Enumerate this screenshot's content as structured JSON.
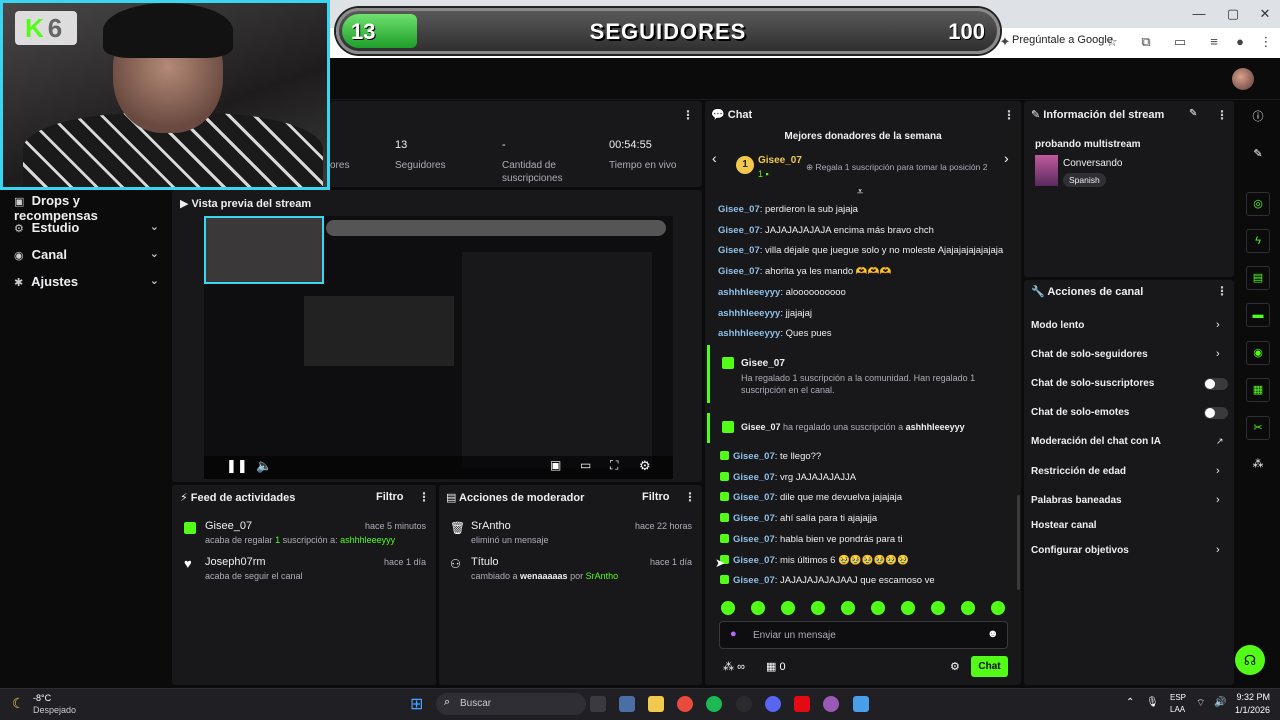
{
  "browser": {
    "ask_google": "Pregúntale a Google"
  },
  "goal_overlay": {
    "current": "13",
    "title": "SEGUIDORES",
    "target": "100",
    "progress": 0.13
  },
  "webcam": {
    "logo_letter": "K",
    "logo_number": "6"
  },
  "stats": [
    {
      "value": "13",
      "label": "Seguidores"
    },
    {
      "value": "-",
      "label": "Cantidad de suscripciones"
    },
    {
      "value": "00:54:55",
      "label": "Tiempo en vivo"
    }
  ],
  "stats_partial_label": "ores",
  "sidebar": {
    "items": [
      {
        "label": "Drops y recompensas",
        "icon": "gift-icon",
        "chevron": false
      },
      {
        "label": "Estudio",
        "icon": "studio-icon",
        "chevron": true
      },
      {
        "label": "Canal",
        "icon": "channel-icon",
        "chevron": true
      },
      {
        "label": "Ajustes",
        "icon": "gear-icon",
        "chevron": true
      }
    ]
  },
  "preview": {
    "title": "Vista previa del stream"
  },
  "activity_feed": {
    "title": "Feed de actividades",
    "filter": "Filtro",
    "items": [
      {
        "name": "Gisee_07",
        "time": "hace 5 minutos",
        "pre": "acaba de regalar ",
        "count": "1",
        "mid": " suscripción a: ",
        "target": "ashhhleeeyyy"
      },
      {
        "name": "Joseph07rm",
        "time": "hace 1 día",
        "text": "acaba de seguir el canal"
      }
    ]
  },
  "mod_actions": {
    "title": "Acciones de moderador",
    "filter": "Filtro",
    "items": [
      {
        "name": "SrAntho",
        "time": "hace 22 horas",
        "text": "eliminó un mensaje"
      },
      {
        "name": "Título",
        "time": "hace 1 día",
        "pre": "cambiado a ",
        "value": "wenaaaaas",
        "by": " por ",
        "user": "SrAntho"
      }
    ]
  },
  "chat": {
    "title": "Chat",
    "top_donors_title": "Mejores donadores de la semana",
    "donor_rank": "1",
    "donor_name": "Gisee_07",
    "donor_count": "1",
    "donor_cta": "Regala 1 suscripción para tomar la posición 2",
    "messages_top": [
      {
        "user": "Gisee_07",
        "text": ": perdieron la sub jajaja"
      },
      {
        "user": "Gisee_07",
        "text": ": JAJAJAJAJAJA encima más bravo chch"
      },
      {
        "user": "Gisee_07",
        "text": ": villa déjale que juegue solo y no moleste Ajajajajajajajaja"
      },
      {
        "user": "Gisee_07",
        "text": ": ahorita ya les mando 🫶🫶🫶"
      },
      {
        "user": "ashhhleeeyyy",
        "text": ": aloooooooooo"
      },
      {
        "user": "ashhhleeeyyy",
        "text": ": jjajajaj"
      },
      {
        "user": "ashhhleeeyyy",
        "text": ": Ques pues"
      }
    ],
    "gift_event": {
      "user": "Gisee_07",
      "text": "Ha regalado 1 suscripción a la comunidad. Han regalado 1 suscripción en el canal."
    },
    "gift_single": {
      "user": "Gisee_07",
      "text": " ha regalado una suscripción a ",
      "target": "ashhhleeeyyy"
    },
    "messages_bottom": [
      {
        "user": "Gisee_07",
        "text": ": te llego??"
      },
      {
        "user": "Gisee_07",
        "text": ": vrg JAJAJAJAJJA"
      },
      {
        "user": "Gisee_07",
        "text": ": dile que me devuelva jajajaja"
      },
      {
        "user": "Gisee_07",
        "text": ": ahí salía para ti ajajajja"
      },
      {
        "user": "Gisee_07",
        "text": ": habla bien ve pondrás para ti"
      },
      {
        "user": "Gisee_07",
        "text": ": mis últimos 6 🥹🥹🥹🥹🥹🥹"
      },
      {
        "user": "Gisee_07",
        "text": ": JAJAJAJAJAJAAJ que escamoso ve"
      }
    ],
    "input_placeholder": "Enviar un mensaje",
    "infinity": "∞",
    "count": "0",
    "send_label": "Chat"
  },
  "stream_info": {
    "title": "Información del stream",
    "stream_title": "probando multistream",
    "category": "Conversando",
    "language": "Spanish"
  },
  "channel_actions": {
    "title": "Acciones de canal",
    "items": [
      {
        "label": "Modo lento",
        "control": "chevron"
      },
      {
        "label": "Chat de solo-seguidores",
        "control": "chevron"
      },
      {
        "label": "Chat de solo-suscriptores",
        "control": "toggle"
      },
      {
        "label": "Chat de solo-emotes",
        "control": "toggle"
      },
      {
        "label": "Moderación del chat con IA",
        "control": "external"
      },
      {
        "label": "Restricción de edad",
        "control": "chevron"
      },
      {
        "label": "Palabras baneadas",
        "control": "chevron"
      },
      {
        "label": "Hostear canal",
        "control": "none"
      },
      {
        "label": "Configurar objetivos",
        "control": "chevron"
      }
    ]
  },
  "taskbar": {
    "temp": "-8°C",
    "weather": "Despejado",
    "search": "Buscar",
    "lang1": "ESP",
    "lang2": "LAA",
    "time": "9:32 PM",
    "date": "1/1/2026"
  },
  "colors": {
    "accent": "#53fc18",
    "panel": "#18181b",
    "background": "#0b0b0c",
    "webcam_border": "#3ad6f0"
  }
}
